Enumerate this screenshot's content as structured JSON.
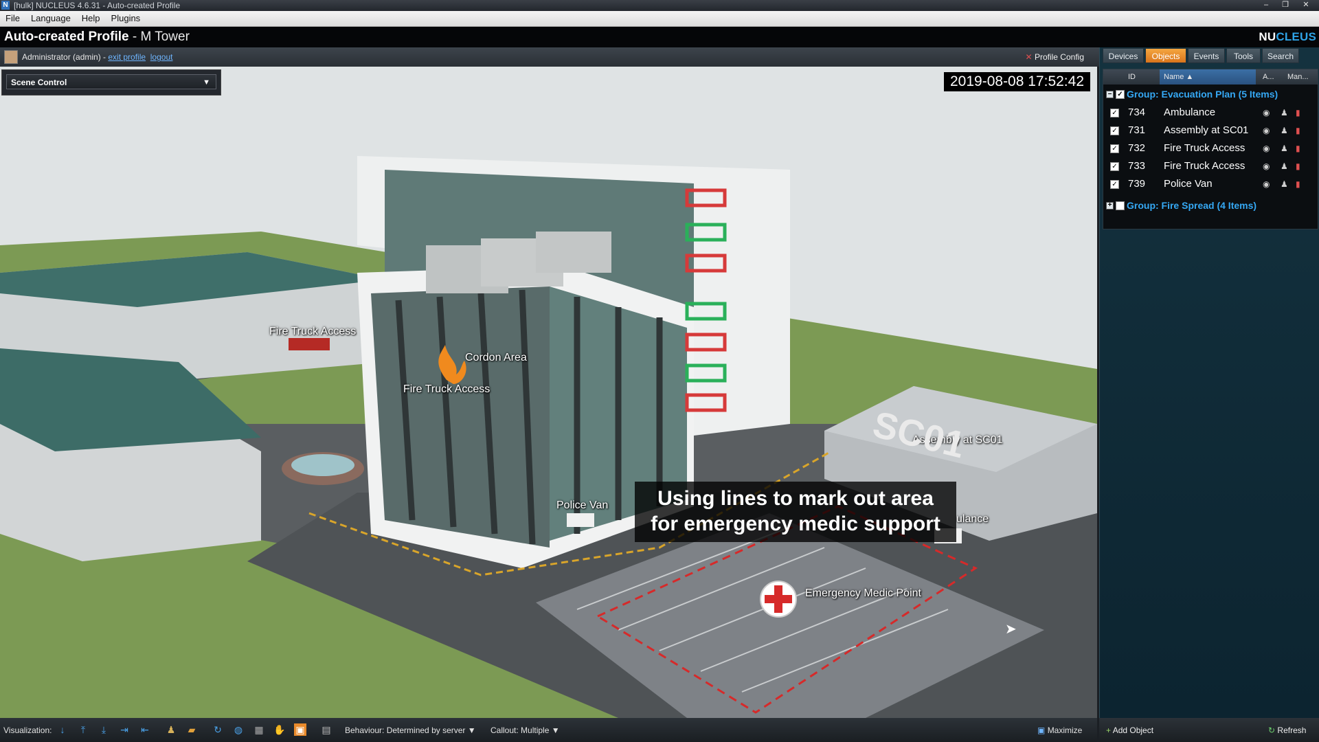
{
  "window": {
    "title": "[hulk] NUCLEUS 4.6.31 - Auto-created Profile",
    "controls": {
      "minimize": "–",
      "restore": "❐",
      "close": "✕"
    }
  },
  "menu": [
    "File",
    "Language",
    "Help",
    "Plugins"
  ],
  "header": {
    "profile_name": "Auto-created Profile",
    "site_name": " - M Tower",
    "brand_nu": "NU",
    "brand_cleus": "CLEUS"
  },
  "userbar": {
    "user": "Administrator (admin) - ",
    "exit_profile": "exit profile",
    "logout": "logout",
    "profile_config": "Profile Config"
  },
  "scene": {
    "control_label": "Scene Control",
    "timestamp": "2019-08-08 17:52:42",
    "labels": {
      "fire_truck_access_1": "Fire Truck Access",
      "cordon_area": "Cordon Area",
      "fire_truck_access_2": "Fire Truck Access",
      "police_van": "Police Van",
      "assembly": "Assembly at SC01",
      "ambulance_partial": "ulance",
      "emergency_medic": "Emergency Medic Point",
      "sc01_marking": "SC01"
    },
    "caption_line1": "Using lines to mark out area",
    "caption_line2": "for emergency medic support"
  },
  "panel": {
    "tabs": [
      "Devices",
      "Objects",
      "Events",
      "Tools",
      "Search"
    ],
    "active_tab": "Objects",
    "columns": {
      "id": "ID",
      "name": "Name",
      "a": "A...",
      "man": "Man..."
    },
    "groups": [
      {
        "title": "Group: Evacuation Plan (5 Items)",
        "expanded": true,
        "checked": true,
        "items": [
          {
            "id": "734",
            "name": "Ambulance"
          },
          {
            "id": "731",
            "name": "Assembly at SC01"
          },
          {
            "id": "732",
            "name": "Fire Truck Access"
          },
          {
            "id": "733",
            "name": "Fire Truck Access"
          },
          {
            "id": "739",
            "name": "Police Van"
          }
        ]
      },
      {
        "title": "Group: Fire Spread (4 Items)",
        "expanded": false,
        "checked": false
      }
    ],
    "add_object": "Add Object",
    "refresh": "Refresh"
  },
  "bottombar": {
    "visualization_label": "Visualization:",
    "behaviour": "Behaviour: Determined by server",
    "callout": "Callout: Multiple",
    "maximize": "Maximize"
  },
  "colors": {
    "accent_orange": "#e98a2b",
    "group_blue": "#35a8f4",
    "brand_blue": "#2fa3e6",
    "medic_red": "#d62a2a"
  }
}
